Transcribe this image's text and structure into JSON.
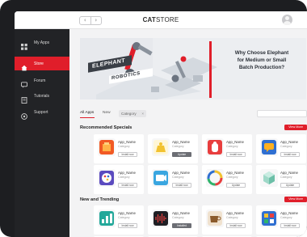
{
  "brand": {
    "part1": "CAT",
    "part2": "STORE"
  },
  "nav": {
    "back": "‹",
    "forward": "›"
  },
  "sidebar": {
    "items": [
      {
        "label": "My Apps",
        "icon": "grid-icon",
        "active": false
      },
      {
        "label": "Store",
        "icon": "house-icon",
        "active": true
      },
      {
        "label": "Forum",
        "icon": "chat-icon",
        "active": false
      },
      {
        "label": "Tutorials",
        "icon": "book-icon",
        "active": false
      },
      {
        "label": "Support",
        "icon": "help-icon",
        "active": false
      }
    ]
  },
  "banner": {
    "title_line1": "Why Choose Elephant",
    "title_line2": "for Medium or Small",
    "title_line3": "Batch Production?",
    "logo_line1": "ELEPHANT",
    "logo_line2": "ROBOTICS"
  },
  "filters": {
    "tab_all": "All Apps",
    "tab_new": "New",
    "chip_label": "Category",
    "chip_close": "×",
    "search_placeholder": ""
  },
  "sections": {
    "recommended": {
      "title": "Recommended Specials",
      "view_more": "View More",
      "apps": [
        {
          "name": "App_Name",
          "category": "Category",
          "button": "Install now",
          "icon": "orange-box-icon",
          "solid": false
        },
        {
          "name": "App_Name",
          "category": "Category",
          "button": "Update",
          "icon": "yellow-weight-icon",
          "solid": true
        },
        {
          "name": "App_Name",
          "category": "Category",
          "button": "Install now",
          "icon": "red-hand-icon",
          "solid": false
        },
        {
          "name": "App_Name",
          "category": "Category",
          "button": "Install now",
          "icon": "blue-chat-icon",
          "solid": false
        },
        {
          "name": "App_Name",
          "category": "Category",
          "button": "Install now",
          "icon": "paint-palette-icon",
          "solid": false
        },
        {
          "name": "App_Name",
          "category": "Category",
          "button": "Install now",
          "icon": "video-play-icon",
          "solid": false
        },
        {
          "name": "App_Name",
          "category": "Category",
          "button": "Update",
          "icon": "color-ring-icon",
          "solid": false
        },
        {
          "name": "App_Name",
          "category": "Category",
          "button": "Update",
          "icon": "green-cube-icon",
          "solid": false
        }
      ]
    },
    "new_trending": {
      "title": "New and Trending",
      "view_more": "View More",
      "apps": [
        {
          "name": "App_Name",
          "category": "Category",
          "button": "Install now",
          "icon": "teal-chart-icon",
          "solid": false
        },
        {
          "name": "App_Name",
          "category": "Category",
          "button": "Installed",
          "icon": "waveform-icon",
          "solid": true
        },
        {
          "name": "App_Name",
          "category": "Category",
          "button": "Install now",
          "icon": "coffee-cup-icon",
          "solid": false
        },
        {
          "name": "App_Name",
          "category": "Category",
          "button": "Install now",
          "icon": "blue-game-icon",
          "solid": false
        }
      ]
    }
  },
  "colors": {
    "accent": "#e01e2a",
    "sidebar": "#222326",
    "bezel": "#1d1e21"
  }
}
